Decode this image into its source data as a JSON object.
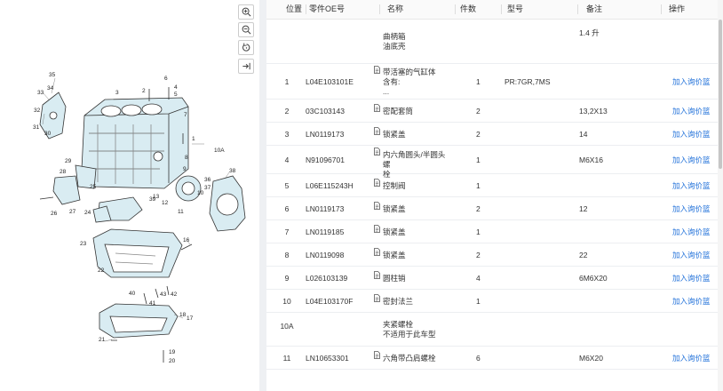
{
  "toolbar": {
    "zoom_in": "zoom-in-icon",
    "zoom_out": "zoom-out-icon",
    "reset": "reset-icon",
    "collapse": "collapse-icon"
  },
  "table": {
    "columns": [
      "位置",
      "零件OE号",
      "名称",
      "件数",
      "型号",
      "备注",
      "操作"
    ],
    "rows": [
      {
        "pos": "",
        "oe": "",
        "name": [
          "曲柄箱",
          "油底壳"
        ],
        "qty": "",
        "type": "",
        "note": "1.4 升",
        "act": "",
        "doc": false
      },
      {
        "pos": "1",
        "oe": "L04E103101E",
        "name": [
          "带活塞的气缸体",
          "含有:",
          "..."
        ],
        "qty": "1",
        "type": "PR:7GR,7MS",
        "note": "",
        "act": "加入询价篮",
        "doc": true
      },
      {
        "pos": "2",
        "oe": "03C103143",
        "name": [
          "密配套筒"
        ],
        "qty": "2",
        "type": "",
        "note": "13,2X13",
        "act": "加入询价篮",
        "doc": true
      },
      {
        "pos": "3",
        "oe": "LN0119173",
        "name": [
          "锁紧盖"
        ],
        "qty": "2",
        "type": "",
        "note": "14",
        "act": "加入询价篮",
        "doc": true
      },
      {
        "pos": "4",
        "oe": "N91096701",
        "name": [
          "内六角圆头/半圆头螺",
          "栓"
        ],
        "qty": "1",
        "type": "",
        "note": "M6X16",
        "act": "加入询价篮",
        "doc": true
      },
      {
        "pos": "5",
        "oe": "L06E115243H",
        "name": [
          "控制阀"
        ],
        "qty": "1",
        "type": "",
        "note": "",
        "act": "加入询价篮",
        "doc": true
      },
      {
        "pos": "6",
        "oe": "LN0119173",
        "name": [
          "锁紧盖"
        ],
        "qty": "2",
        "type": "",
        "note": "12",
        "act": "加入询价篮",
        "doc": true
      },
      {
        "pos": "7",
        "oe": "LN0119185",
        "name": [
          "锁紧盖"
        ],
        "qty": "1",
        "type": "",
        "note": "",
        "act": "加入询价篮",
        "doc": true
      },
      {
        "pos": "8",
        "oe": "LN0119098",
        "name": [
          "锁紧盖"
        ],
        "qty": "2",
        "type": "",
        "note": "22",
        "act": "加入询价篮",
        "doc": true
      },
      {
        "pos": "9",
        "oe": "L026103139",
        "name": [
          "圆柱销"
        ],
        "qty": "4",
        "type": "",
        "note": "6M6X20",
        "act": "加入询价篮",
        "doc": true
      },
      {
        "pos": "10",
        "oe": "L04E103170F",
        "name": [
          "密封法兰"
        ],
        "qty": "1",
        "type": "",
        "note": "",
        "act": "加入询价篮",
        "doc": true
      },
      {
        "pos": "10A",
        "oe": "",
        "name": [
          "夹紧螺栓",
          "不适用于此车型"
        ],
        "qty": "",
        "type": "",
        "note": "",
        "act": "",
        "doc": false
      },
      {
        "pos": "11",
        "oe": "LN10653301",
        "name": [
          "六角带凸肩螺栓"
        ],
        "qty": "6",
        "type": "",
        "note": "M6X20",
        "act": "加入询价篮",
        "doc": true
      }
    ]
  },
  "callouts": [
    "35",
    "34",
    "33",
    "32",
    "31",
    "30",
    "3",
    "2",
    "6",
    "4",
    "5",
    "7",
    "1",
    "10A",
    "8",
    "9",
    "10",
    "36",
    "37",
    "38",
    "28",
    "29",
    "27",
    "26",
    "25",
    "24",
    "22",
    "23",
    "39",
    "13",
    "12",
    "11",
    "16",
    "40",
    "41",
    "43",
    "42",
    "18",
    "17",
    "21",
    "19",
    "20"
  ]
}
